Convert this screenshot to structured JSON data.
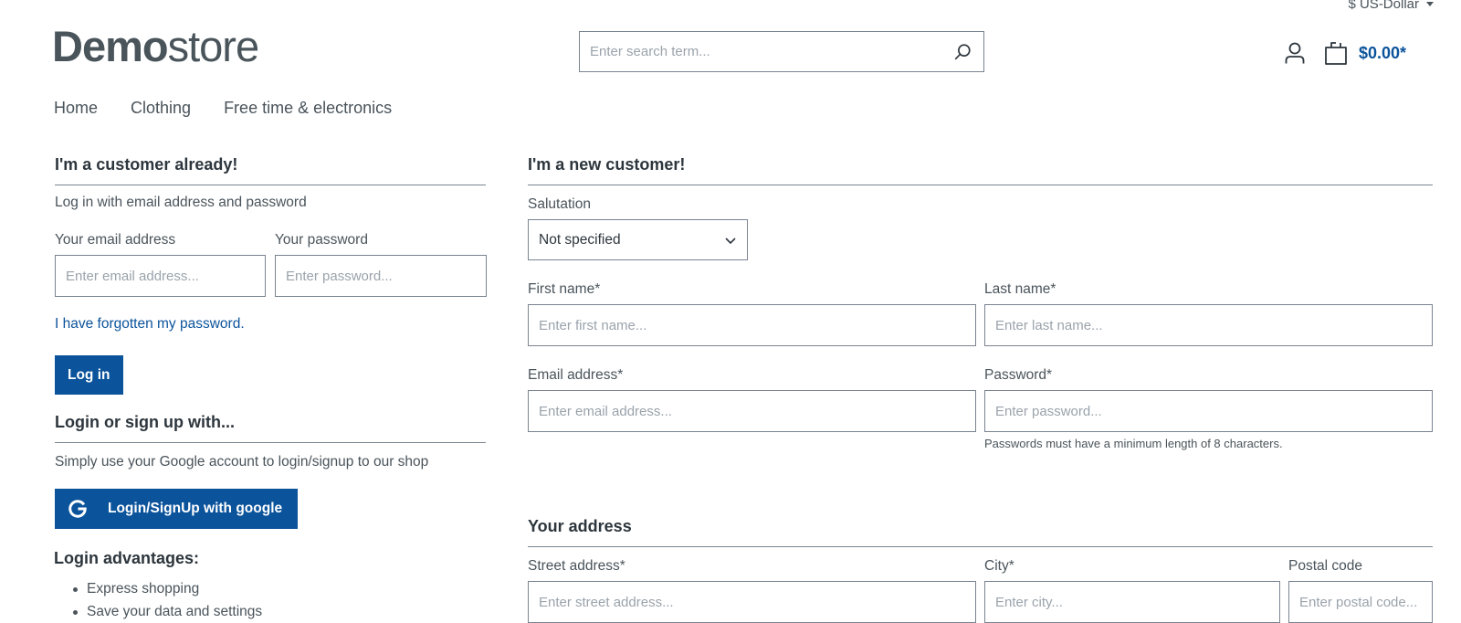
{
  "header": {
    "currency_label": "$ US-Dollar",
    "logo_bold": "Demo",
    "logo_light": "store",
    "search_placeholder": "Enter search term...",
    "cart_total": "$0.00*",
    "brand_color": "#0b539b"
  },
  "nav": {
    "items": [
      {
        "label": "Home"
      },
      {
        "label": "Clothing"
      },
      {
        "label": "Free time & electronics"
      }
    ]
  },
  "login": {
    "title": "I'm a customer already!",
    "intro": "Log in with email address and password",
    "email_label": "Your email address",
    "email_placeholder": "Enter email address...",
    "password_label": "Your password",
    "password_placeholder": "Enter password...",
    "forgot_link": "I have forgotten my password.",
    "login_button": "Log in"
  },
  "social": {
    "title": "Login or sign up with...",
    "intro": "Simply use your Google account to login/signup to our shop",
    "google_button": "Login/SignUp with google",
    "google_icon": "google-g-icon"
  },
  "advantages": {
    "title": "Login advantages:",
    "items": [
      {
        "label": "Express shopping"
      },
      {
        "label": "Save your data and settings"
      }
    ]
  },
  "register": {
    "title": "I'm a new customer!",
    "salutation_label": "Salutation",
    "salutation_value": "Not specified",
    "first_name_label": "First name*",
    "first_name_placeholder": "Enter first name...",
    "last_name_label": "Last name*",
    "last_name_placeholder": "Enter last name...",
    "email_label": "Email address*",
    "email_placeholder": "Enter email address...",
    "password_label": "Password*",
    "password_placeholder": "Enter password...",
    "password_hint": "Passwords must have a minimum length of 8 characters."
  },
  "address": {
    "title": "Your address",
    "street_label": "Street address*",
    "street_placeholder": "Enter street address...",
    "city_label": "City*",
    "city_placeholder": "Enter city...",
    "postal_label": "Postal code",
    "postal_placeholder": "Enter postal code..."
  }
}
